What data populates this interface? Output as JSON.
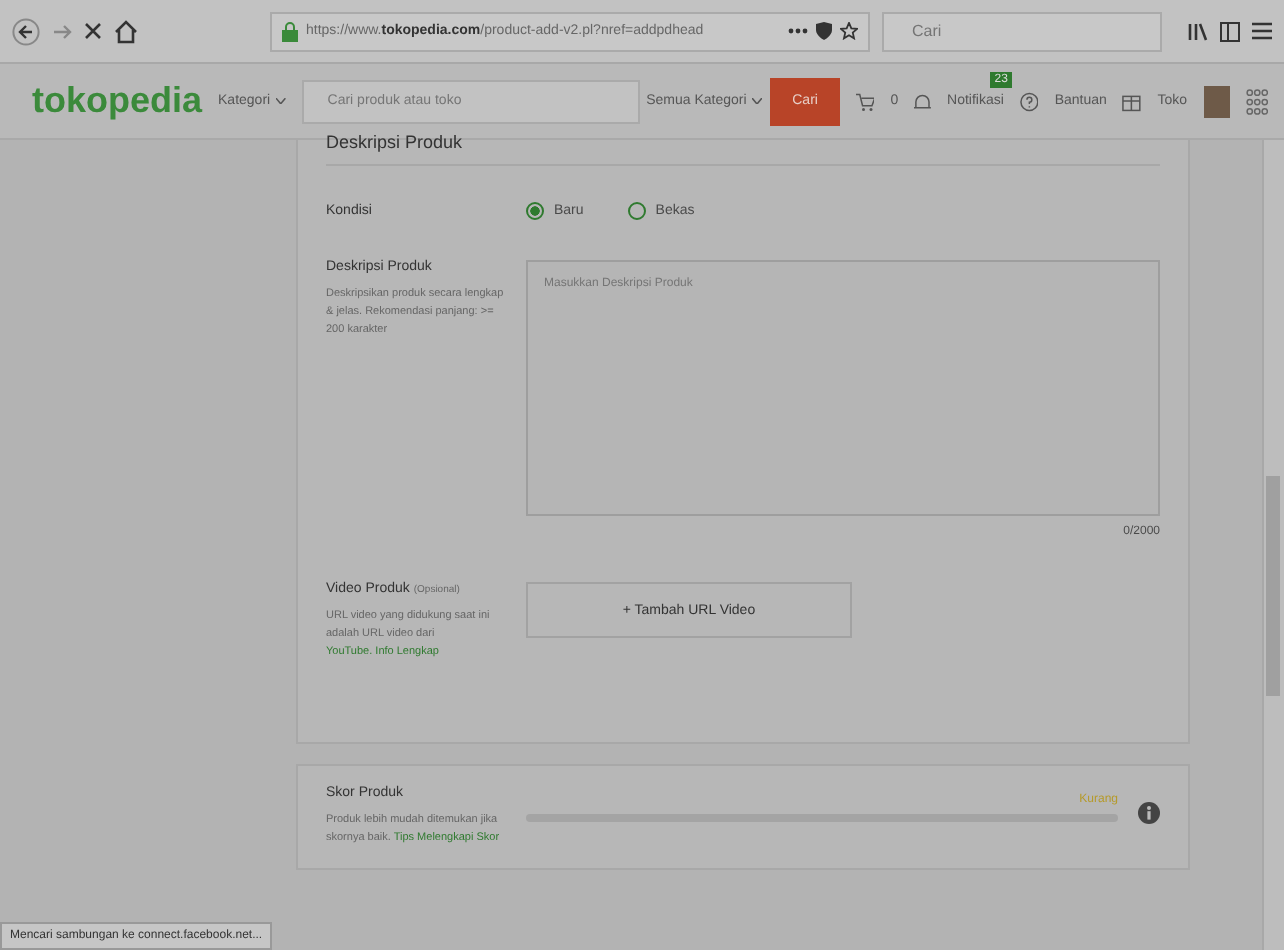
{
  "browser": {
    "url": "https://www.**tokopedia.com**/product-add-v2.pl?nref=addpdhead",
    "search_placeholder": "Cari"
  },
  "header": {
    "logo": "tokopedia",
    "category_menu": "Kategori",
    "search_placeholder": "Cari produk atau toko",
    "category_select": "Semua Kategori",
    "search_button": "Cari",
    "cart_count": "0",
    "notification": "Notifikasi",
    "notification_badge": "23",
    "help": "Bantuan",
    "shop": "Toko"
  },
  "section_title": "Deskripsi Produk",
  "condition": {
    "label": "Kondisi",
    "options": [
      {
        "label": "Baru",
        "selected": true
      },
      {
        "label": "Bekas",
        "selected": false
      }
    ]
  },
  "description": {
    "label": "Deskripsi Produk",
    "help": "Deskripsikan produk secara lengkap & jelas. Rekomendasi panjang: >= 200 karakter",
    "placeholder": "Masukkan Deskripsi Produk",
    "counter": "0/2000"
  },
  "video": {
    "label": "Video Produk",
    "optional": "(Opsional)",
    "help": "URL video yang didukung saat ini adalah URL video dari",
    "link": "YouTube. Info Lengkap",
    "button": "+ Tambah URL Video"
  },
  "score": {
    "title": "Skor Produk",
    "help": "Produk lebih mudah ditemukan jika skornya baik.",
    "link": "Tips Melengkapi Skor",
    "status": "Kurang",
    "level": 0
  },
  "status_bar": "Mencari sambungan ke connect.facebook.net..."
}
